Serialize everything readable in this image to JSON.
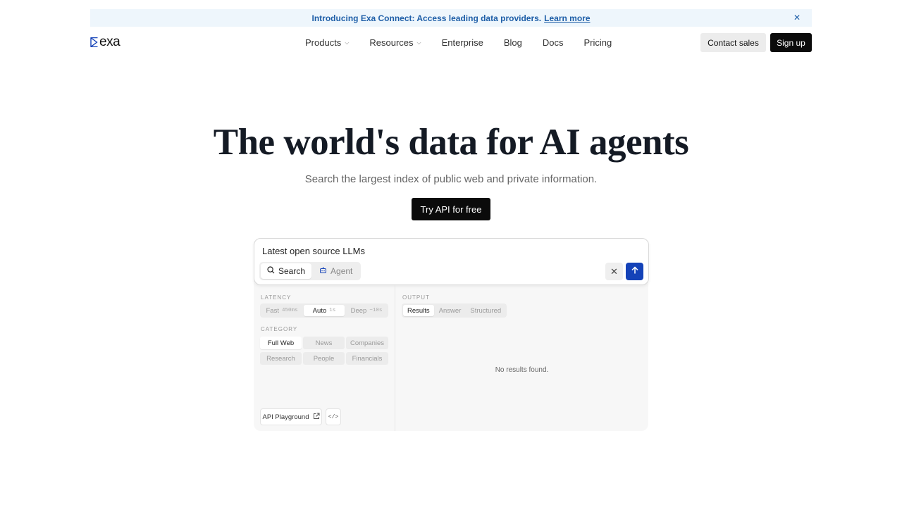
{
  "banner": {
    "message": "Introducing Exa Connect: Access leading data providers.",
    "link": "Learn more",
    "close_icon": "close-icon"
  },
  "nav": {
    "logo_text": "exa",
    "items": [
      {
        "label": "Products",
        "has_dropdown": true
      },
      {
        "label": "Resources",
        "has_dropdown": true
      },
      {
        "label": "Enterprise",
        "has_dropdown": false
      },
      {
        "label": "Blog",
        "has_dropdown": false
      },
      {
        "label": "Docs",
        "has_dropdown": false
      },
      {
        "label": "Pricing",
        "has_dropdown": false
      }
    ],
    "contact_label": "Contact sales",
    "signup_label": "Sign up"
  },
  "hero": {
    "title": "The world's data for AI agents",
    "subtitle": "Search the largest index of public web and private information.",
    "cta_label": "Try API for free"
  },
  "search": {
    "query": "Latest open source LLMs",
    "modes": [
      {
        "label": "Search",
        "icon": "search-icon",
        "active": true
      },
      {
        "label": "Agent",
        "icon": "robot-icon",
        "active": false
      }
    ],
    "accent": "#1442b8"
  },
  "latency": {
    "label": "LATENCY",
    "options": [
      {
        "label": "Fast",
        "hint": "450ms",
        "active": false
      },
      {
        "label": "Auto",
        "hint": "1s",
        "active": true
      },
      {
        "label": "Deep",
        "hint": "~10s",
        "active": false
      }
    ]
  },
  "category": {
    "label": "CATEGORY",
    "options": [
      {
        "label": "Full Web",
        "active": true
      },
      {
        "label": "News",
        "active": false
      },
      {
        "label": "Companies",
        "active": false
      },
      {
        "label": "Research",
        "active": false
      },
      {
        "label": "People",
        "active": false
      },
      {
        "label": "Financials",
        "active": false
      }
    ]
  },
  "output": {
    "label": "OUTPUT",
    "tabs": [
      {
        "label": "Results",
        "active": true
      },
      {
        "label": "Answer",
        "active": false
      },
      {
        "label": "Structured",
        "active": false
      }
    ],
    "empty_text": "No results found."
  },
  "footer_tools": {
    "playground_label": "API Playground",
    "code_label": "</>"
  }
}
